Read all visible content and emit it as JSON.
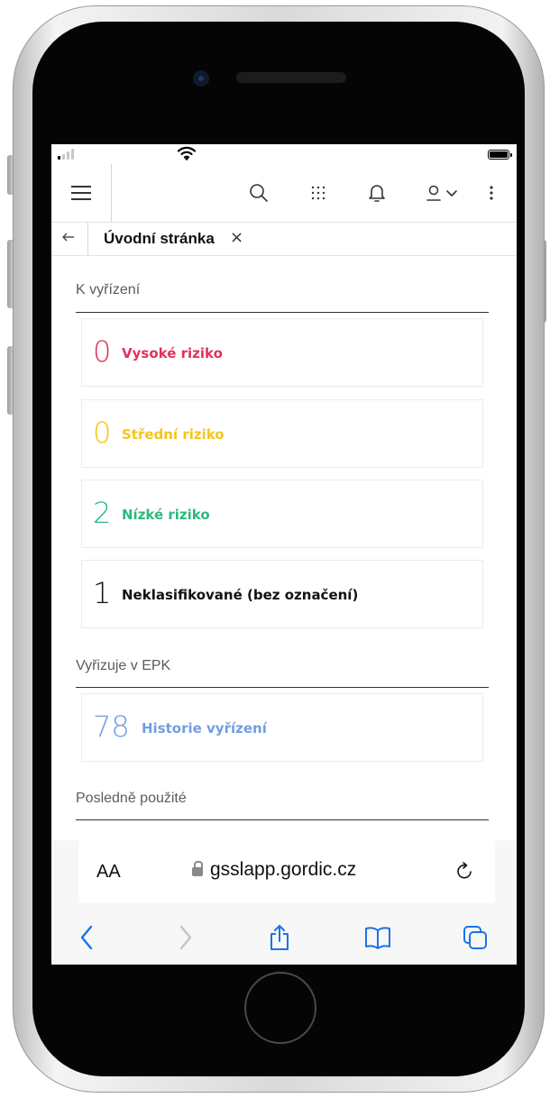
{
  "app": {
    "header": {
      "menu_icon": "hamburger-menu-icon",
      "icons": [
        "search-icon",
        "apps-grid-icon",
        "bell-icon",
        "user-icon",
        "chevron-down-icon",
        "more-vertical-icon"
      ]
    },
    "tab": {
      "back_icon": "back-arrow-icon",
      "label": "Úvodní stránka",
      "close_label": "×"
    },
    "sections": {
      "pending": {
        "title": "K vyřízení",
        "cards": [
          {
            "count": "0",
            "label": "Vysoké riziko",
            "color": "#e0335a"
          },
          {
            "count": "0",
            "label": "Střední riziko",
            "color": "#f5c518"
          },
          {
            "count": "2",
            "label": "Nízké riziko",
            "color": "#2bb980"
          },
          {
            "count": "1",
            "label": "Neklasifikované (bez označení)",
            "color": "#111111"
          }
        ]
      },
      "epk": {
        "title": "Vyřizuje v EPK",
        "card": {
          "count": "78",
          "label": "Historie vyřízení",
          "color": "#6f9ee3"
        }
      },
      "recent": {
        "title": "Posledně použité"
      }
    }
  },
  "browser": {
    "text_size_label": "AA",
    "url": "gsslapp.gordic.cz",
    "toolbar_icons": [
      "back-icon",
      "forward-icon",
      "share-icon",
      "bookmarks-icon",
      "tabs-icon"
    ]
  }
}
